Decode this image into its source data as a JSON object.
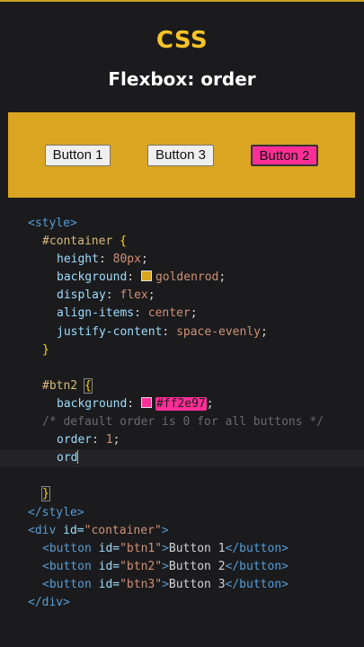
{
  "header": {
    "title": "CSS",
    "subtitle": "Flexbox: order"
  },
  "demo": {
    "buttons": [
      {
        "label": "Button 1",
        "color": "#efefef"
      },
      {
        "label": "Button 3",
        "color": "#efefef"
      },
      {
        "label": "Button 2",
        "color": "#ff2e97"
      }
    ],
    "container_color": "#daa520"
  },
  "code": {
    "style_open": "<style>",
    "selector_container": "#container",
    "open_brace": " {",
    "height_prop": "height",
    "height_val": "80px",
    "background_prop": "background",
    "goldenrod_val": "goldenrod",
    "display_prop": "display",
    "display_val": "flex",
    "align_prop": "align-items",
    "align_val": "center",
    "justify_prop": "justify-content",
    "justify_val": "space-evenly",
    "close_brace": "}",
    "selector_btn2": "#btn2",
    "pink_val": "#ff2e97",
    "comment": "/* default order is 0 for all buttons */",
    "order_prop": "order",
    "order_val": "1",
    "typing": "ord",
    "style_close": "</style>",
    "div_open_tag": "<div",
    "div_attr": "id=",
    "div_attr_val": "\"container\"",
    "gt": ">",
    "btn_tag_open": "<button",
    "btn_attr": "id=",
    "btn1_id": "\"btn1\"",
    "btn2_id": "\"btn2\"",
    "btn3_id": "\"btn3\"",
    "btn1_text": "Button 1",
    "btn2_text": "Button 2",
    "btn3_text": "Button 3",
    "btn_tag_close": "</button>",
    "div_close": "</div>"
  }
}
